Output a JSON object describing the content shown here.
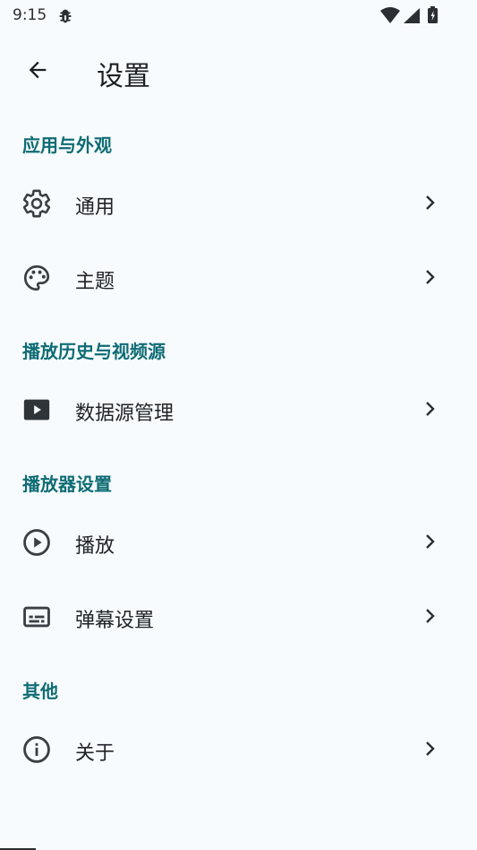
{
  "status_bar": {
    "time": "9:15"
  },
  "header": {
    "title": "设置",
    "back_icon": "arrow-left-icon"
  },
  "sections": [
    {
      "title": "应用与外观",
      "items": [
        {
          "label": "通用",
          "icon": "gear-icon"
        },
        {
          "label": "主题",
          "icon": "palette-icon"
        }
      ]
    },
    {
      "title": "播放历史与视频源",
      "items": [
        {
          "label": "数据源管理",
          "icon": "video-source-icon"
        }
      ]
    },
    {
      "title": "播放器设置",
      "items": [
        {
          "label": "播放",
          "icon": "play-circle-icon"
        },
        {
          "label": "弹幕设置",
          "icon": "subtitles-icon"
        }
      ]
    },
    {
      "title": "其他",
      "items": [
        {
          "label": "关于",
          "icon": "info-icon"
        }
      ]
    }
  ],
  "colors": {
    "accent": "#0f6c74",
    "background": "#f7fbfe",
    "text": "#1f2226"
  }
}
